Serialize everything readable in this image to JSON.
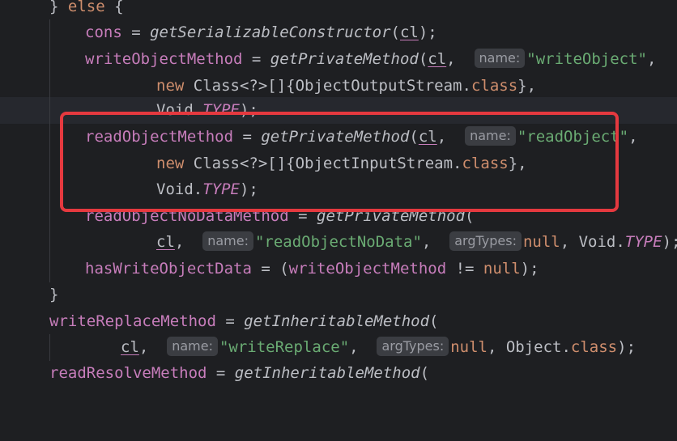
{
  "editor": {
    "lines": [
      {
        "id": "l0",
        "tokens": [
          {
            "t": "} ",
            "c": "plain"
          },
          {
            "t": "else",
            "c": "kw"
          },
          {
            "t": " {",
            "c": "plain"
          }
        ]
      },
      {
        "id": "l1",
        "tokens": [
          {
            "t": "cons",
            "c": "field"
          },
          {
            "t": " = ",
            "c": "plain"
          },
          {
            "t": "getSerializableConstructor",
            "c": "method"
          },
          {
            "t": "(",
            "c": "plain"
          },
          {
            "t": "cl",
            "c": "param"
          },
          {
            "t": ");",
            "c": "plain"
          }
        ]
      },
      {
        "id": "l2",
        "tokens": [
          {
            "t": "writeObjectMethod",
            "c": "field"
          },
          {
            "t": " = ",
            "c": "plain"
          },
          {
            "t": "getPrivateMethod",
            "c": "method"
          },
          {
            "t": "(",
            "c": "plain"
          },
          {
            "t": "cl",
            "c": "param"
          },
          {
            "t": ",  ",
            "c": "plain"
          },
          {
            "t": "name:",
            "c": "hint"
          },
          {
            "t": "\"writeObject\"",
            "c": "string"
          },
          {
            "t": ",",
            "c": "plain"
          }
        ]
      },
      {
        "id": "l3",
        "tokens": [
          {
            "t": "new",
            "c": "kw"
          },
          {
            "t": " Class<?>[]{ObjectOutputStream.",
            "c": "plain"
          },
          {
            "t": "class",
            "c": "kw"
          },
          {
            "t": "},",
            "c": "plain"
          }
        ]
      },
      {
        "id": "l4",
        "tokens": [
          {
            "t": "Void.",
            "c": "plain"
          },
          {
            "t": "TYPE",
            "c": "const"
          },
          {
            "t": ");",
            "c": "plain"
          }
        ]
      },
      {
        "id": "l5",
        "tokens": [
          {
            "t": "readObjectMethod",
            "c": "field"
          },
          {
            "t": " = ",
            "c": "plain"
          },
          {
            "t": "getPrivateMethod",
            "c": "method"
          },
          {
            "t": "(",
            "c": "plain"
          },
          {
            "t": "cl",
            "c": "param"
          },
          {
            "t": ",  ",
            "c": "plain"
          },
          {
            "t": "name:",
            "c": "hint"
          },
          {
            "t": "\"readObject\"",
            "c": "string"
          },
          {
            "t": ",",
            "c": "plain"
          }
        ]
      },
      {
        "id": "l6",
        "tokens": [
          {
            "t": "new",
            "c": "kw"
          },
          {
            "t": " Class<?>[]{ObjectInputStream.",
            "c": "plain"
          },
          {
            "t": "class",
            "c": "kw"
          },
          {
            "t": "},",
            "c": "plain"
          }
        ]
      },
      {
        "id": "l7",
        "tokens": [
          {
            "t": "Void.",
            "c": "plain"
          },
          {
            "t": "TYPE",
            "c": "const"
          },
          {
            "t": ");",
            "c": "plain"
          }
        ]
      },
      {
        "id": "l8",
        "tokens": [
          {
            "t": "readObjectNoDataMethod",
            "c": "field"
          },
          {
            "t": " = ",
            "c": "plain"
          },
          {
            "t": "getPrivateMethod",
            "c": "method"
          },
          {
            "t": "(",
            "c": "plain"
          }
        ]
      },
      {
        "id": "l9",
        "tokens": [
          {
            "t": "cl",
            "c": "param"
          },
          {
            "t": ",  ",
            "c": "plain"
          },
          {
            "t": "name:",
            "c": "hint"
          },
          {
            "t": "\"readObjectNoData\"",
            "c": "string"
          },
          {
            "t": ",  ",
            "c": "plain"
          },
          {
            "t": "argTypes:",
            "c": "hint"
          },
          {
            "t": "null",
            "c": "kw"
          },
          {
            "t": ", Void.",
            "c": "plain"
          },
          {
            "t": "TYPE",
            "c": "const"
          },
          {
            "t": ");",
            "c": "plain"
          }
        ]
      },
      {
        "id": "l10",
        "tokens": [
          {
            "t": "hasWriteObjectData",
            "c": "field"
          },
          {
            "t": " = (",
            "c": "plain"
          },
          {
            "t": "writeObjectMethod",
            "c": "field"
          },
          {
            "t": " != ",
            "c": "plain"
          },
          {
            "t": "null",
            "c": "kw"
          },
          {
            "t": ");",
            "c": "plain"
          }
        ]
      },
      {
        "id": "l11",
        "tokens": [
          {
            "t": "}",
            "c": "plain"
          }
        ]
      },
      {
        "id": "l12",
        "tokens": [
          {
            "t": "writeReplaceMethod",
            "c": "field"
          },
          {
            "t": " = ",
            "c": "plain"
          },
          {
            "t": "getInheritableMethod",
            "c": "method"
          },
          {
            "t": "(",
            "c": "plain"
          }
        ]
      },
      {
        "id": "l13",
        "tokens": [
          {
            "t": "cl",
            "c": "param"
          },
          {
            "t": ",  ",
            "c": "plain"
          },
          {
            "t": "name:",
            "c": "hint"
          },
          {
            "t": "\"writeReplace\"",
            "c": "string"
          },
          {
            "t": ",  ",
            "c": "plain"
          },
          {
            "t": "argTypes:",
            "c": "hint"
          },
          {
            "t": "null",
            "c": "kw"
          },
          {
            "t": ", Object.",
            "c": "plain"
          },
          {
            "t": "class",
            "c": "kw"
          },
          {
            "t": ");",
            "c": "plain"
          }
        ]
      },
      {
        "id": "l14",
        "tokens": [
          {
            "t": "readResolveMethod",
            "c": "field"
          },
          {
            "t": " = ",
            "c": "plain"
          },
          {
            "t": "getInheritableMethod",
            "c": "method"
          },
          {
            "t": "(",
            "c": "plain"
          }
        ]
      }
    ]
  },
  "colors": {
    "background": "#1e1f22",
    "highlight_box": "#e5393f",
    "field": "#c77dbb",
    "string": "#6aab73",
    "keyword": "#cf8e6d"
  }
}
